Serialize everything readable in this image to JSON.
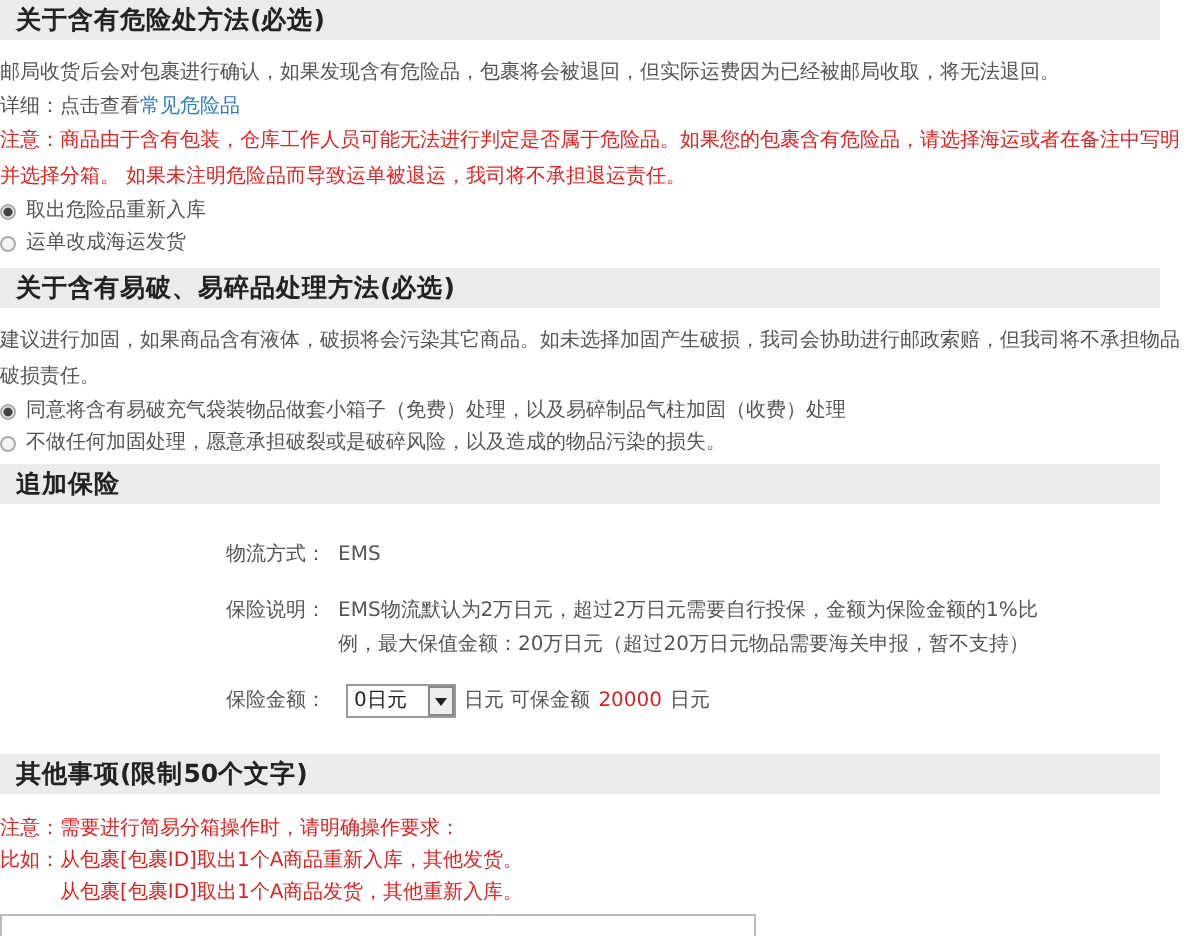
{
  "sections": [
    {
      "title": "关于含有危险处方法(必选)",
      "items": [
        {
          "kind": "text",
          "text": "邮局收货后会对包裹进行确认，如果发现含有危险品，包裹将会被退回，但实际运费因为已经被邮局收取，将无法退回。"
        },
        {
          "kind": "link_line",
          "label": "详细：点击查看",
          "link": "常见危险品"
        },
        {
          "kind": "warning",
          "text": "注意：商品由于含有包装，仓库工作人员可能无法进行判定是否属于危险品。如果您的包裹含有危险品，请选择海运或者在备注中写明并选择分箱。 如果未注明危险品而导致运单被退运，我司将不承担退运责任。"
        },
        {
          "kind": "radio",
          "label": "取出危险品重新入库",
          "selected": true
        },
        {
          "kind": "radio",
          "label": "运单改成海运发货",
          "selected": false
        }
      ]
    },
    {
      "title": "关于含有易破、易碎品处理方法(必选)",
      "items": [
        {
          "kind": "text",
          "text": "建议进行加固，如果商品含有液体，破损将会污染其它商品。如未选择加固产生破损，我司会协助进行邮政索赔，但我司将不承担物品破损责任。"
        },
        {
          "kind": "radio",
          "label": "同意将含有易破充气袋装物品做套小箱子（免费）处理，以及易碎制品气柱加固（收费）处理",
          "selected": true
        },
        {
          "kind": "radio",
          "label": "不做任何加固处理，愿意承担破裂或是破碎风险，以及造成的物品污染的损失。",
          "selected": false
        }
      ]
    },
    {
      "title": "追加保险",
      "items": [
        {
          "kind": "field",
          "label": "物流方式：",
          "value": "EMS"
        },
        {
          "kind": "field",
          "label": "保险说明：",
          "value": "EMS物流默认为2万日元，超过2万日元需要自行投保，金额为保险金额的1%比例，最大保值金额：20万日元（超过20万日元物品需要海关申报，暂不支持）"
        },
        {
          "kind": "amount",
          "label": "保险金额：",
          "select": "0日元",
          "unit": "日元 可保金额",
          "available": "20000",
          "available_unit": "日元"
        }
      ]
    },
    {
      "title": "其他事项(限制50个文字)",
      "items": [
        {
          "kind": "notes",
          "lines": [
            {
              "prefix": "注意：",
              "text": "需要进行简易分箱操作时，请明确操作要求："
            },
            {
              "prefix": "比如：",
              "text": "从包裹[包裹ID]取出1个A商品重新入库，其他发货。"
            },
            {
              "text": "从包裹[包裹ID]取出1个A商品发货，其他重新入库。"
            }
          ]
        },
        {
          "kind": "textarea"
        }
      ]
    }
  ]
}
